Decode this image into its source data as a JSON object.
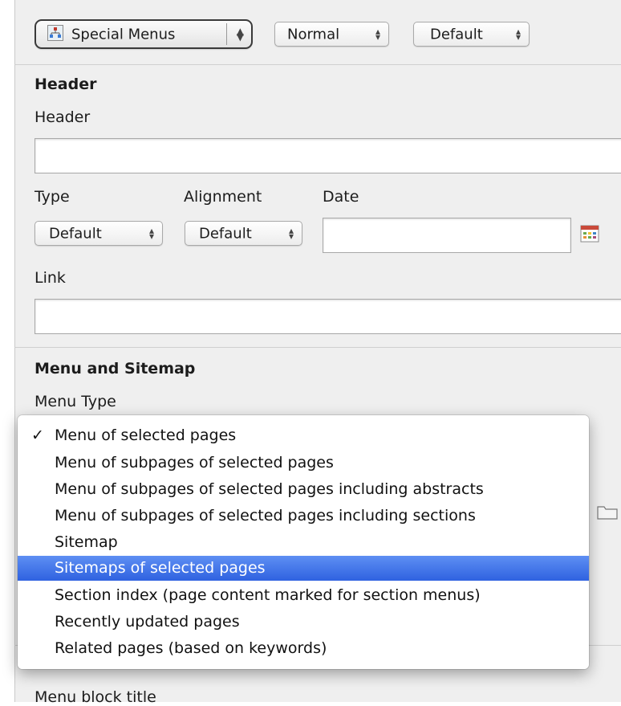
{
  "toolbar": {
    "selects": [
      {
        "label": "Special Menus",
        "icon": "sitemap-icon"
      },
      {
        "label": "Normal"
      },
      {
        "label": "Default"
      }
    ]
  },
  "header_section": {
    "title": "Header",
    "header_label": "Header",
    "type_label": "Type",
    "alignment_label": "Alignment",
    "date_label": "Date",
    "type_value": "Default",
    "alignment_value": "Default",
    "link_label": "Link"
  },
  "menu_section": {
    "title": "Menu and Sitemap",
    "menu_type_label": "Menu Type",
    "menu_type_options": [
      "Menu of selected pages",
      "Menu of subpages of selected pages",
      "Menu of subpages of selected pages including abstracts",
      "Menu of subpages of selected pages including sections",
      "Sitemap",
      "Sitemaps of selected pages",
      "Section index (page content marked for section menus)",
      "Recently updated pages",
      "Related pages (based on keywords)"
    ],
    "checked_option": "Menu of selected pages",
    "highlighted_option": "Sitemaps of selected pages",
    "check_glyph": "✓"
  },
  "accessibility": {
    "menu_block_title_label": "Menu block title"
  },
  "colors": {
    "highlight": "#3a6ee8",
    "panel_bg": "#efefef"
  }
}
